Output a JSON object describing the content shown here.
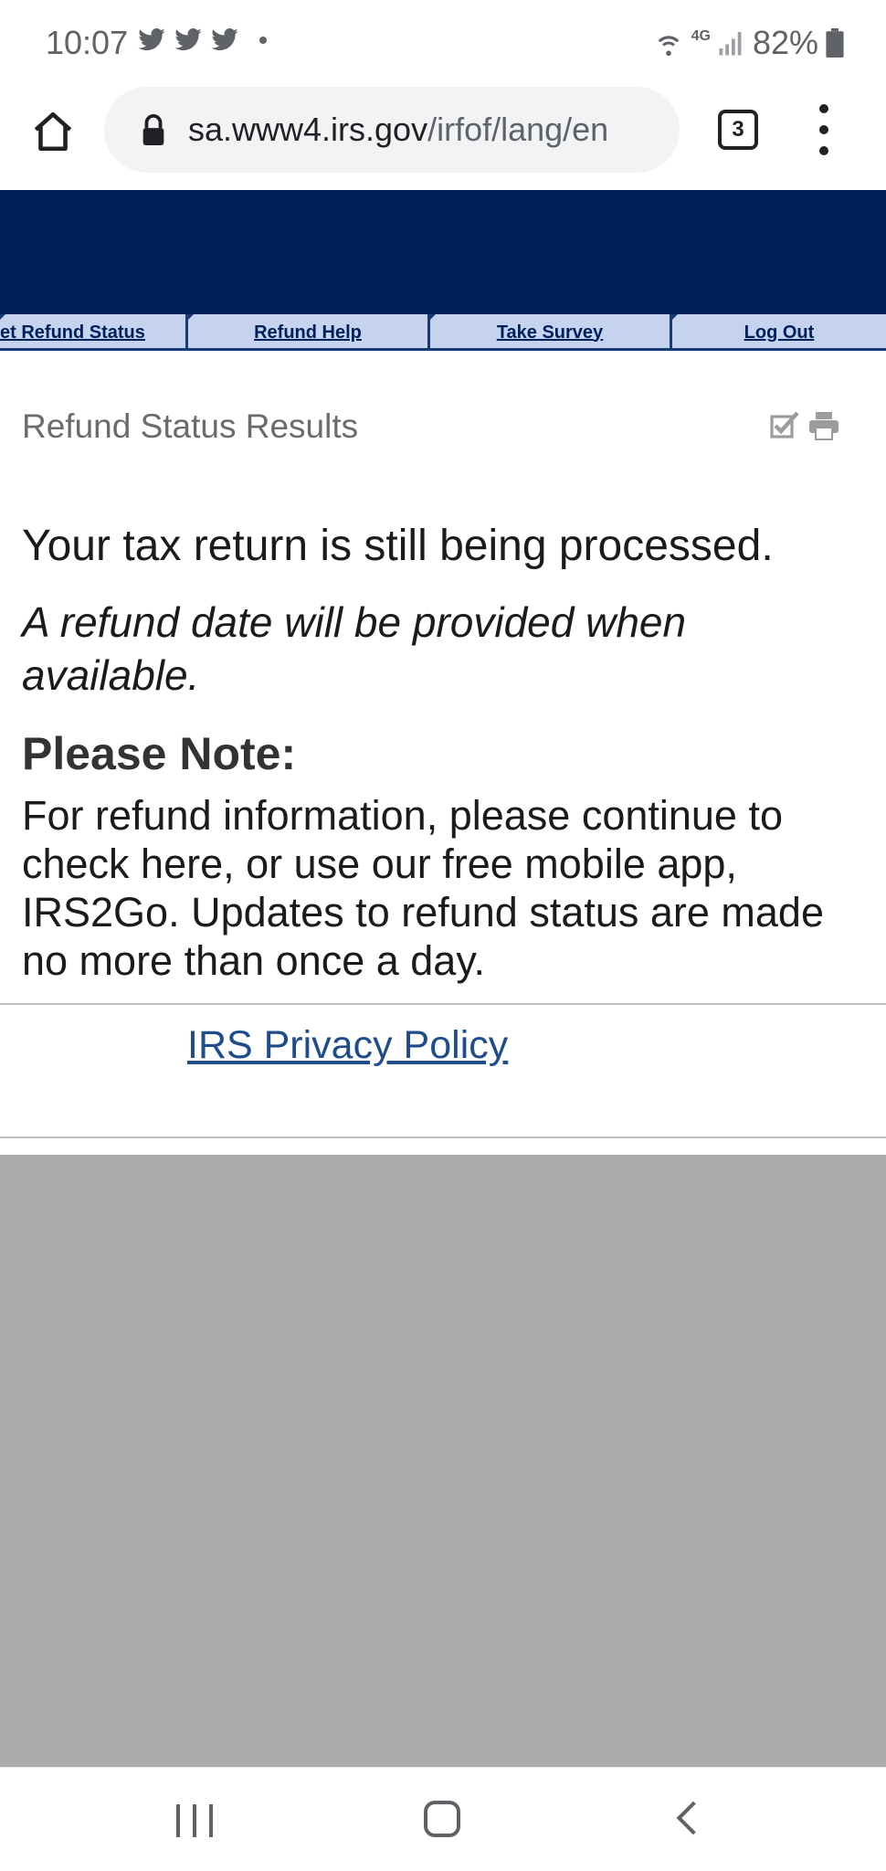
{
  "status_bar": {
    "time": "10:07",
    "battery": "82%",
    "network": "4G",
    "notification_icons": [
      "twitter-icon",
      "twitter-icon",
      "twitter-icon"
    ]
  },
  "browser": {
    "url_host": "sa.www4.irs.gov",
    "url_path": "/irfof/lang/en",
    "tab_count": "3"
  },
  "nav": {
    "items": [
      {
        "label": "et Refund Status"
      },
      {
        "label": "Refund Help"
      },
      {
        "label": "Take Survey"
      },
      {
        "label": "Log Out"
      }
    ]
  },
  "page": {
    "section_title": "Refund Status Results",
    "main_message": "Your tax return is still being processed.",
    "italic_message": "A refund date will be provided when available.",
    "note_title": "Please Note:",
    "note_body": "For refund information, please continue to check here, or use our free mobile app, IRS2Go. Updates to refund status are made no more than once a day.",
    "privacy_link": "IRS Privacy Policy"
  },
  "colors": {
    "header": "#001f5b",
    "nav_bg": "#c6d3ee",
    "link": "#1f4d8c"
  }
}
